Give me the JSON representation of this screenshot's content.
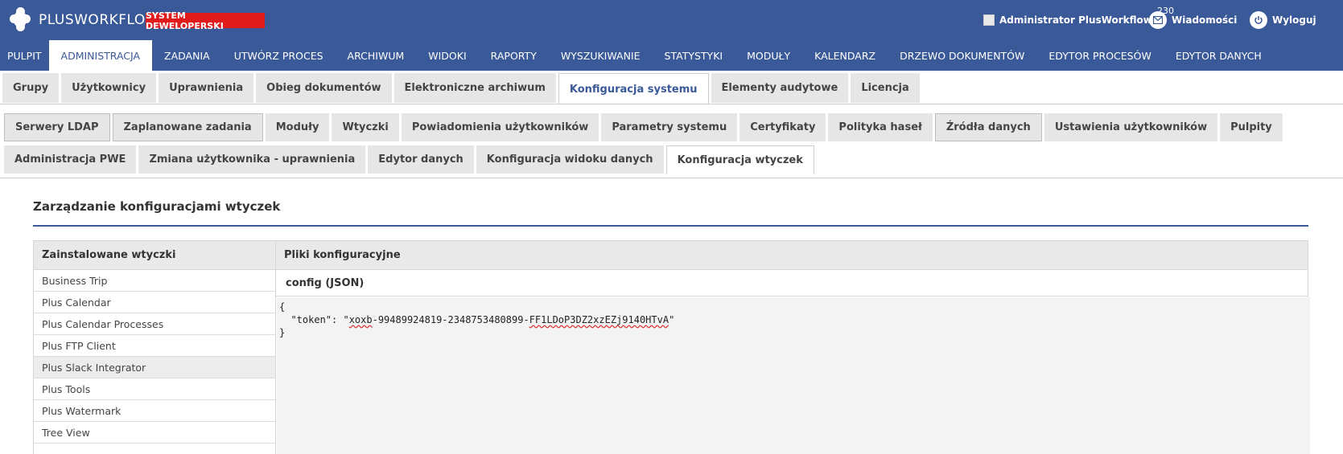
{
  "header": {
    "logo_plus": "PLUS",
    "logo_workflow": "WORKFLOW",
    "system_badge": "SYSTEM DEWELOPERSKI",
    "user_name": "Administrator PlusWorkflow",
    "messages_count": "230",
    "messages_label": "Wiadomości",
    "logout_label": "Wyloguj"
  },
  "main_nav": [
    "PULPIT",
    "ADMINISTRACJA",
    "ZADANIA",
    "UTWÓRZ PROCES",
    "ARCHIWUM",
    "WIDOKI",
    "RAPORTY",
    "WYSZUKIWANIE",
    "STATYSTYKI",
    "MODUŁY",
    "KALENDARZ",
    "DRZEWO DOKUMENTÓW",
    "EDYTOR PROCESÓW",
    "EDYTOR DANYCH"
  ],
  "tabs_level1": [
    "Grupy",
    "Użytkownicy",
    "Uprawnienia",
    "Obieg dokumentów",
    "Elektroniczne archiwum",
    "Konfiguracja systemu",
    "Elementy audytowe",
    "Licencja"
  ],
  "tabs_level2": [
    "Serwery LDAP",
    "Zaplanowane zadania",
    "Moduły",
    "Wtyczki",
    "Powiadomienia użytkowników",
    "Parametry systemu",
    "Certyfikaty",
    "Polityka haseł",
    "Źródła danych",
    "Ustawienia użytkowników",
    "Pulpity",
    "Administracja PWE",
    "Zmiana użytkownika - uprawnienia",
    "Edytor danych",
    "Konfiguracja widoku danych",
    "Konfiguracja wtyczek"
  ],
  "section_title": "Zarządzanie konfiguracjami wtyczek",
  "left_panel": {
    "title": "Zainstalowane wtyczki",
    "items": [
      "Business Trip",
      "Plus Calendar",
      "Plus Calendar Processes",
      "Plus FTP Client",
      "Plus Slack Integrator",
      "Plus Tools",
      "Plus Watermark",
      "Tree View"
    ]
  },
  "right_panel": {
    "title": "Pliki konfiguracyjne",
    "config_label": "config (JSON)",
    "editor": {
      "line1": "{",
      "line2_prefix": "  \"token\": \"",
      "token_part1": "xoxb",
      "token_mid": "-99489924819-2348753480899-",
      "token_part2": "FF1LDoP3DZ2xzEZj9140HTvA",
      "line2_suffix": "\"",
      "line3": "}"
    }
  }
}
